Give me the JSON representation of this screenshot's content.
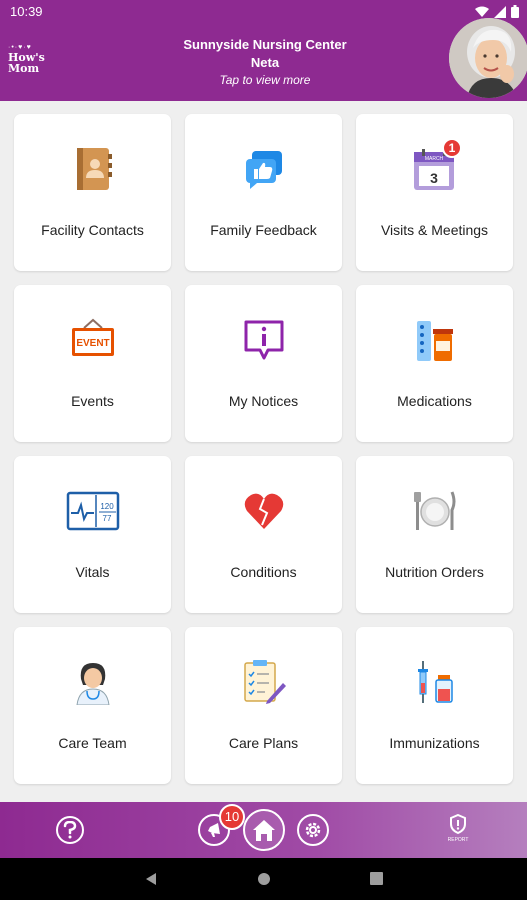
{
  "status": {
    "time": "10:39"
  },
  "header": {
    "logo_line1": "How's",
    "logo_line2": "Mom",
    "facility_name": "Sunnyside Nursing Center",
    "resident_name": "Neta",
    "tap_hint": "Tap to view more"
  },
  "tiles": [
    {
      "label": "Facility Contacts",
      "icon": "contact-book-icon"
    },
    {
      "label": "Family Feedback",
      "icon": "thumbs-up-chat-icon"
    },
    {
      "label": "Visits & Meetings",
      "icon": "calendar-icon",
      "badge": "1",
      "calendar_day": "3",
      "calendar_month": "MARCH"
    },
    {
      "label": "Events",
      "icon": "event-sign-icon",
      "sign_text": "EVENT"
    },
    {
      "label": "My Notices",
      "icon": "info-chat-icon"
    },
    {
      "label": "Medications",
      "icon": "medication-icon"
    },
    {
      "label": "Vitals",
      "icon": "vitals-monitor-icon",
      "bp_top": "120",
      "bp_bottom": "77"
    },
    {
      "label": "Conditions",
      "icon": "heart-icon"
    },
    {
      "label": "Nutrition Orders",
      "icon": "plate-cutlery-icon"
    },
    {
      "label": "Care Team",
      "icon": "nurse-icon"
    },
    {
      "label": "Care Plans",
      "icon": "care-plan-icon"
    },
    {
      "label": "Immunizations",
      "icon": "vaccine-icon"
    }
  ],
  "bottom_nav": {
    "help_icon": "question-icon",
    "announcements_badge": "10",
    "home_icon": "home-icon",
    "settings_icon": "gear-icon",
    "report_label": "REPORT"
  },
  "colors": {
    "brand": "#8e2a91",
    "badge": "#e53935"
  }
}
